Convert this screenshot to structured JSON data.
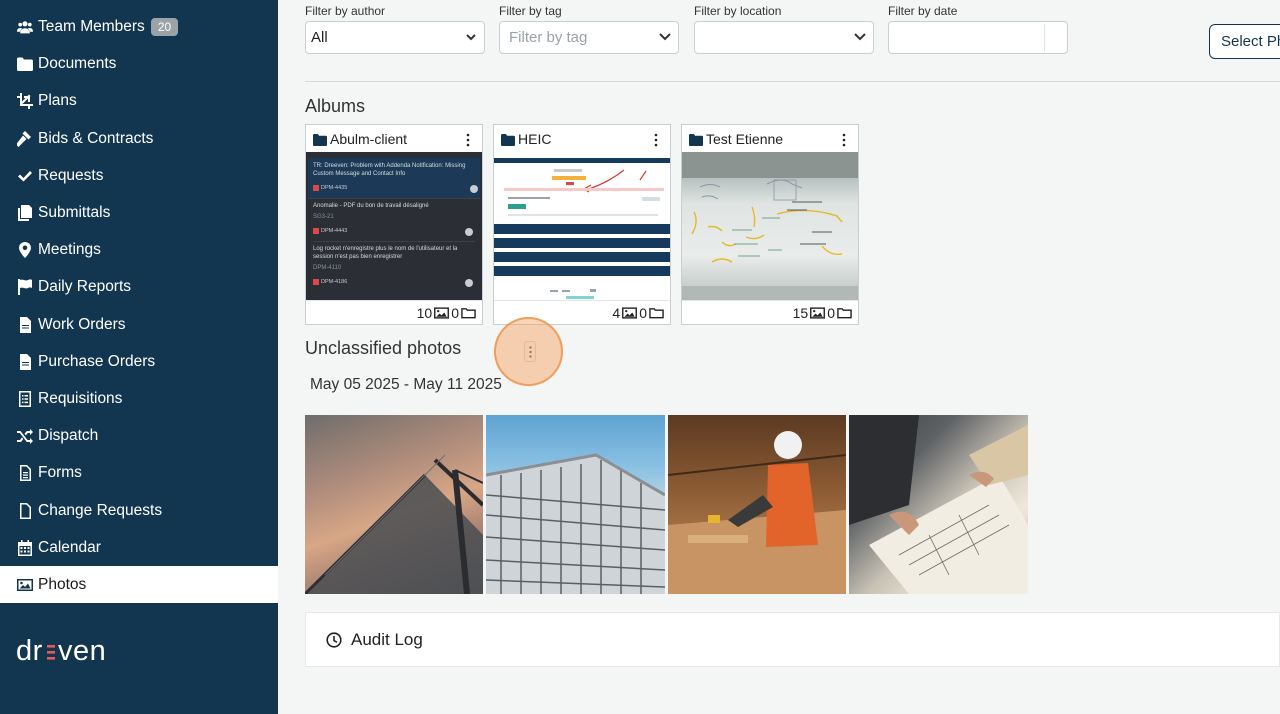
{
  "sidebar": {
    "items": [
      {
        "label": "Team Members",
        "icon": "users-icon",
        "badge": "20"
      },
      {
        "label": "Documents",
        "icon": "folder-icon"
      },
      {
        "label": "Plans",
        "icon": "crop-icon"
      },
      {
        "label": "Bids & Contracts",
        "icon": "gavel-icon"
      },
      {
        "label": "Requests",
        "icon": "check-icon"
      },
      {
        "label": "Submittals",
        "icon": "copy-icon"
      },
      {
        "label": "Meetings",
        "icon": "map-pin-icon"
      },
      {
        "label": "Daily Reports",
        "icon": "flag-icon"
      },
      {
        "label": "Work Orders",
        "icon": "file-icon"
      },
      {
        "label": "Purchase Orders",
        "icon": "file-icon"
      },
      {
        "label": "Requisitions",
        "icon": "list-icon"
      },
      {
        "label": "Dispatch",
        "icon": "shuffle-icon"
      },
      {
        "label": "Forms",
        "icon": "file-lines-icon"
      },
      {
        "label": "Change Requests",
        "icon": "file-outline-icon"
      },
      {
        "label": "Calendar",
        "icon": "calendar-icon"
      },
      {
        "label": "Photos",
        "icon": "image-icon",
        "active": true
      }
    ],
    "logo": "dreeven"
  },
  "filters": {
    "author": {
      "label": "Filter by author",
      "value": "All"
    },
    "tag": {
      "label": "Filter by tag",
      "placeholder": "Filter by tag"
    },
    "location": {
      "label": "Filter by location",
      "value": ""
    },
    "date": {
      "label": "Filter by date",
      "value": ""
    }
  },
  "select_button": "Select Ph",
  "albums_title": "Albums",
  "albums": [
    {
      "name": "Abulm-client",
      "photos": "10",
      "folders": "0",
      "thumb_lines": [
        "TR: Dreeven: Problem with Addenda Notification: Missing Custom Message and Contact Info",
        "DPM-4435",
        "Anomalie - PDF du bon de travail désaligné",
        "SG3-21",
        "DPM-4443",
        "Log rocket n'enregistre plus le nom de l'utilisateur et la session n'est pas bien enregistrer",
        "DPM-4110",
        "DPM-4186"
      ]
    },
    {
      "name": "HEIC",
      "photos": "4",
      "folders": "0"
    },
    {
      "name": "Test Etienne",
      "photos": "15",
      "folders": "0"
    }
  ],
  "unclassified_title": "Unclassified photos",
  "date_range": "May 05 2025 - May 11 2025",
  "photos": [
    {
      "subject": "crane-photo"
    },
    {
      "subject": "building-frame-photo"
    },
    {
      "subject": "worker-photo"
    },
    {
      "subject": "blueprint-photo"
    }
  ],
  "audit_log": "Audit Log",
  "colors": {
    "sidebar": "#133650",
    "accent": "#133650",
    "click_marker": "#f5a05a"
  }
}
